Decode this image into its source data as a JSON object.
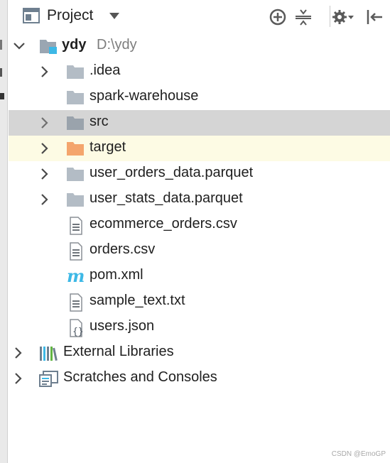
{
  "toolbar": {
    "title": "Project",
    "icons": [
      "project-view-icon",
      "dropdown-arrow-icon",
      "locate-icon",
      "collapse-all-icon",
      "settings-gear-icon",
      "hide-panel-icon"
    ]
  },
  "tree": {
    "root": {
      "name": "ydy",
      "path": "D:\\ydy",
      "expanded": true
    },
    "items": [
      {
        "label": ".idea",
        "icon": "folder-icon",
        "expandable": true
      },
      {
        "label": "spark-warehouse",
        "icon": "folder-icon",
        "expandable": false
      },
      {
        "label": "src",
        "icon": "folder-icon",
        "expandable": true,
        "selected": true
      },
      {
        "label": "target",
        "icon": "excluded-folder-icon",
        "expandable": true,
        "hovered": true
      },
      {
        "label": "user_orders_data.parquet",
        "icon": "folder-icon",
        "expandable": true
      },
      {
        "label": "user_stats_data.parquet",
        "icon": "folder-icon",
        "expandable": true
      },
      {
        "label": "ecommerce_orders.csv",
        "icon": "text-file-icon",
        "expandable": false
      },
      {
        "label": "orders.csv",
        "icon": "text-file-icon",
        "expandable": false
      },
      {
        "label": "pom.xml",
        "icon": "maven-icon",
        "expandable": false
      },
      {
        "label": "sample_text.txt",
        "icon": "text-file-icon",
        "expandable": false
      },
      {
        "label": "users.json",
        "icon": "json-file-icon",
        "expandable": false
      }
    ],
    "top_level": [
      {
        "label": "External Libraries",
        "icon": "libraries-icon"
      },
      {
        "label": "Scratches and Consoles",
        "icon": "scratches-icon"
      }
    ]
  },
  "colors": {
    "selected_row": "#d5d5d5",
    "hover_row": "#fdfbe4",
    "folder": "#b3bcc5",
    "excluded_folder": "#f4a56c",
    "module_folder": "#9aa6b2",
    "maven": "#3db8e6"
  },
  "watermark": "CSDN @EmoGP"
}
